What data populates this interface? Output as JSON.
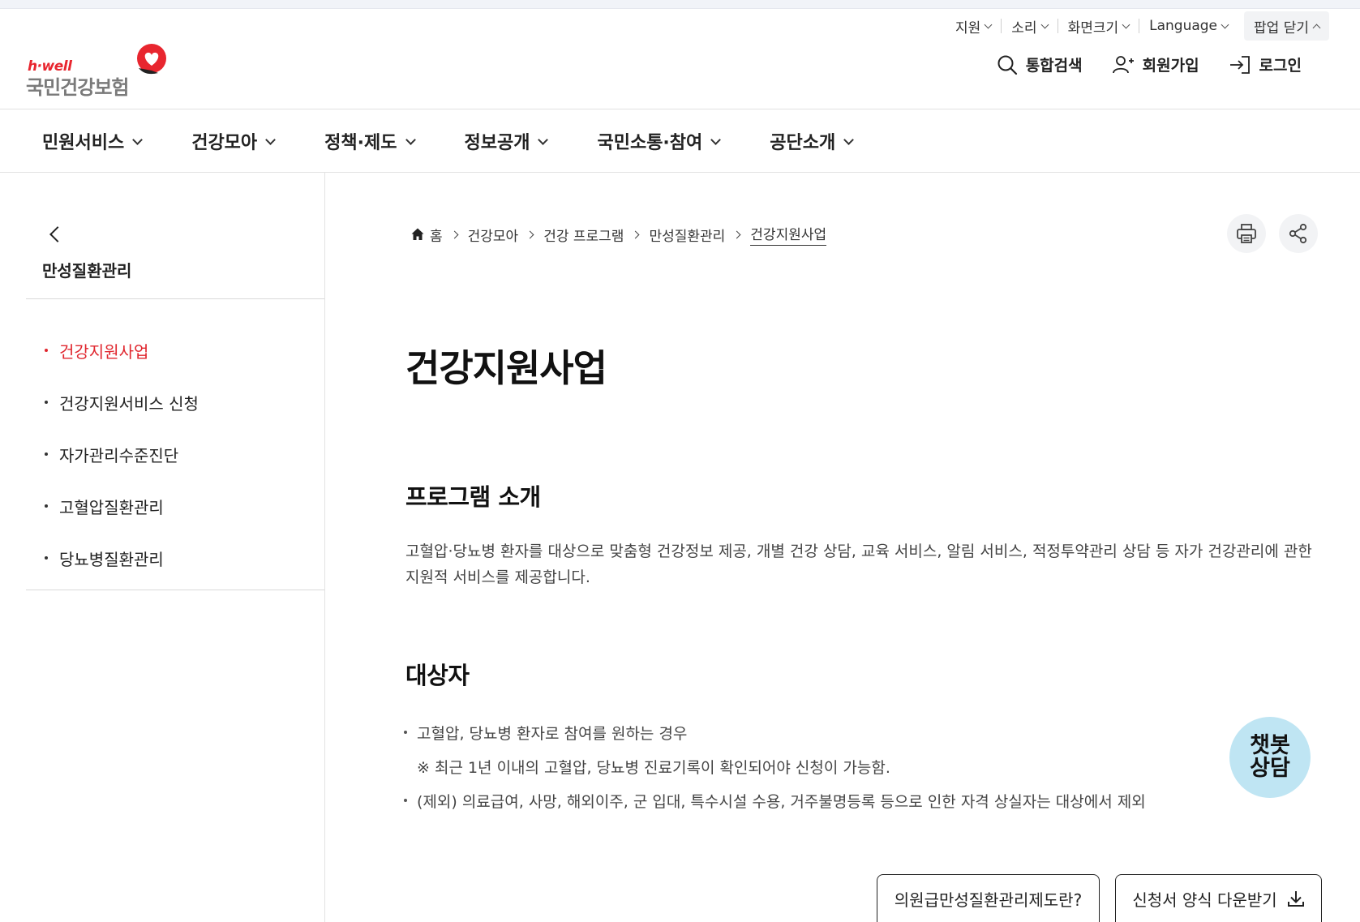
{
  "utility": {
    "items": [
      {
        "label": "지원"
      },
      {
        "label": "소리"
      },
      {
        "label": "화면크기"
      },
      {
        "label": "Language"
      }
    ],
    "popup_close": "팝업 닫기"
  },
  "logo": {
    "tagline": "h·well",
    "name": "국민건강보험"
  },
  "actions": {
    "search": "통합검색",
    "signup": "회원가입",
    "login": "로그인"
  },
  "gnb": {
    "items": [
      {
        "label": "민원서비스"
      },
      {
        "label": "건강모아"
      },
      {
        "label": "정책·제도"
      },
      {
        "label": "정보공개"
      },
      {
        "label": "국민소통·참여"
      },
      {
        "label": "공단소개"
      }
    ]
  },
  "sidebar": {
    "title": "만성질환관리",
    "items": [
      {
        "label": "건강지원사업",
        "active": true
      },
      {
        "label": "건강지원서비스 신청"
      },
      {
        "label": "자가관리수준진단"
      },
      {
        "label": "고혈압질환관리"
      },
      {
        "label": "당뇨병질환관리"
      }
    ]
  },
  "breadcrumb": {
    "home": "홈",
    "items": [
      "건강모아",
      "건강 프로그램",
      "만성질환관리"
    ],
    "current": "건강지원사업"
  },
  "main": {
    "title": "건강지원사업",
    "section1": {
      "title": "프로그램 소개",
      "body": "고혈압·당뇨병 환자를 대상으로 맞춤형 건강정보 제공, 개별 건강 상담, 교육 서비스, 알림 서비스, 적정투약관리 상담 등 자가 건강관리에 관한 지원적 서비스를 제공합니다."
    },
    "section2": {
      "title": "대상자",
      "bullet1": "고혈압, 당뇨병 환자로 참여를 원하는 경우",
      "note": "※ 최근 1년 이내의 고혈압, 당뇨병 진료기록이 확인되어야 신청이 가능함.",
      "bullet2": "(제외) 의료급여, 사망, 해외이주, 군 입대, 특수시설 수용, 거주불명등록 등으로 인한 자격 상실자는 대상에서 제외"
    }
  },
  "chatbot": {
    "line1": "챗봇",
    "line2": "상담"
  },
  "buttons": {
    "info": "의원급만성질환관리제도란?",
    "download": "신청서 양식 다운받기"
  },
  "colors": {
    "accent": "#e0262e",
    "chatbot_bg": "#bfe5f3"
  }
}
